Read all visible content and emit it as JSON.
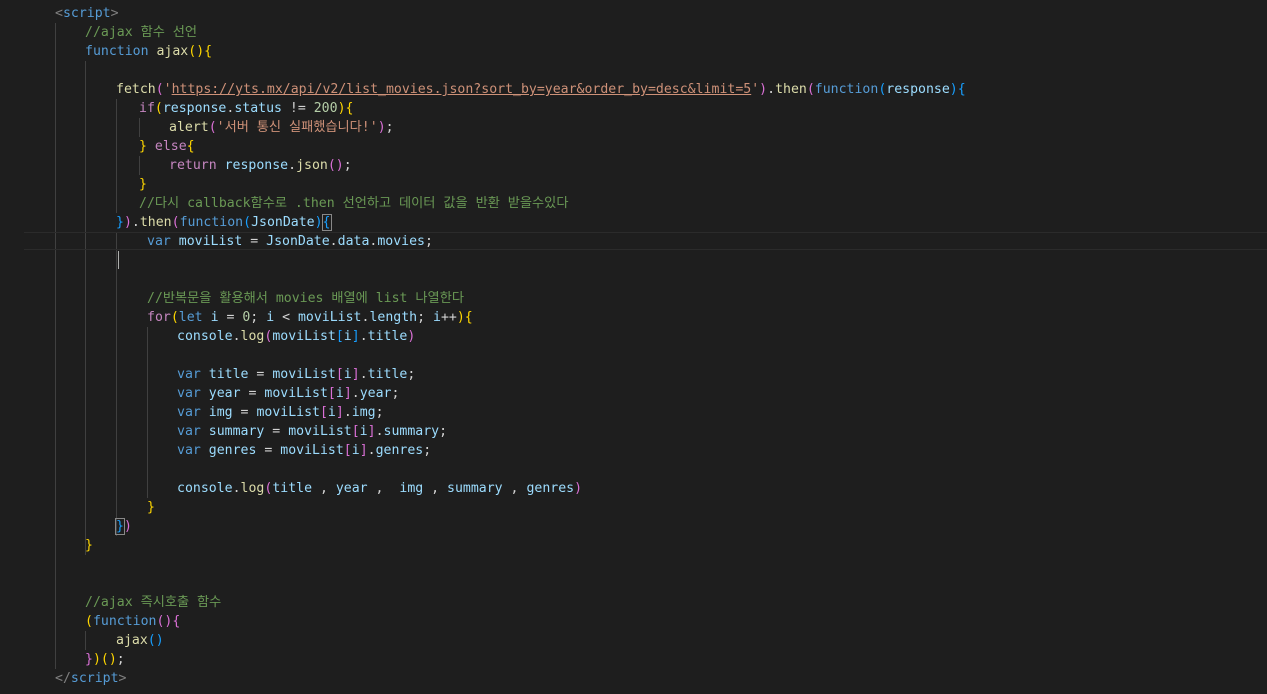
{
  "editor": {
    "colors": {
      "background": "#1e1e1e",
      "keyword": "#569cd6",
      "control": "#c586c0",
      "function": "#dcdcaa",
      "string": "#ce9178",
      "variable": "#9cdcfe",
      "number": "#b5cea8",
      "comment": "#6a9955"
    },
    "lines": [
      [
        {
          "t": "<",
          "c": "punc"
        },
        {
          "t": "script",
          "c": "tag"
        },
        {
          "t": ">",
          "c": "punc"
        }
      ],
      [
        {
          "t": "//ajax 함수 선언",
          "c": "com"
        }
      ],
      [
        {
          "t": "function",
          "c": "kw"
        },
        {
          "t": " "
        },
        {
          "t": "ajax",
          "c": "fn"
        },
        {
          "t": "(){",
          "c": "br1"
        }
      ],
      [],
      [
        {
          "t": "fetch",
          "c": "fn"
        },
        {
          "t": "(",
          "c": "br2"
        },
        {
          "t": "'",
          "c": "str"
        },
        {
          "t": "https://yts.mx/api/v2/list_movies.json?sort_by=year&order_by=desc&limit=5",
          "c": "url"
        },
        {
          "t": "'",
          "c": "str"
        },
        {
          "t": ")",
          "c": "br2"
        },
        {
          "t": "."
        },
        {
          "t": "then",
          "c": "fn"
        },
        {
          "t": "(",
          "c": "br2"
        },
        {
          "t": "function",
          "c": "kw"
        },
        {
          "t": "(",
          "c": "br3"
        },
        {
          "t": "response",
          "c": "var"
        },
        {
          "t": ")",
          "c": "br3"
        },
        {
          "t": "{",
          "c": "br3"
        }
      ],
      [
        {
          "t": "if",
          "c": "ctrl"
        },
        {
          "t": "(",
          "c": "br1"
        },
        {
          "t": "response",
          "c": "var"
        },
        {
          "t": "."
        },
        {
          "t": "status",
          "c": "var"
        },
        {
          "t": " != "
        },
        {
          "t": "200",
          "c": "num"
        },
        {
          "t": ")",
          "c": "br1"
        },
        {
          "t": "{",
          "c": "br1"
        }
      ],
      [
        {
          "t": "alert",
          "c": "fn"
        },
        {
          "t": "(",
          "c": "br2"
        },
        {
          "t": "'서버 통신 실패했습니다!'",
          "c": "str"
        },
        {
          "t": ")",
          "c": "br2"
        },
        {
          "t": ";"
        }
      ],
      [
        {
          "t": "}",
          "c": "br1"
        },
        {
          "t": " "
        },
        {
          "t": "else",
          "c": "ctrl"
        },
        {
          "t": "{",
          "c": "br1"
        }
      ],
      [
        {
          "t": "return",
          "c": "ctrl"
        },
        {
          "t": " "
        },
        {
          "t": "response",
          "c": "var"
        },
        {
          "t": "."
        },
        {
          "t": "json",
          "c": "fn"
        },
        {
          "t": "()",
          "c": "br2"
        },
        {
          "t": ";"
        }
      ],
      [
        {
          "t": "}",
          "c": "br1"
        }
      ],
      [
        {
          "t": "//다시 callback함수로 .then 선언하고 데이터 값을 반환 받을수있다",
          "c": "com"
        }
      ],
      [
        {
          "t": "}",
          "c": "br3"
        },
        {
          "t": ")",
          "c": "br2"
        },
        {
          "t": "."
        },
        {
          "t": "then",
          "c": "fn"
        },
        {
          "t": "(",
          "c": "br2"
        },
        {
          "t": "function",
          "c": "kw"
        },
        {
          "t": "(",
          "c": "br3"
        },
        {
          "t": "JsonDate",
          "c": "var"
        },
        {
          "t": ")",
          "c": "br3"
        },
        {
          "t": "{",
          "c": "br3",
          "m": 1
        }
      ],
      [
        {
          "t": "var",
          "c": "kw"
        },
        {
          "t": " "
        },
        {
          "t": "moviList",
          "c": "var"
        },
        {
          "t": " = "
        },
        {
          "t": "JsonDate",
          "c": "var"
        },
        {
          "t": "."
        },
        {
          "t": "data",
          "c": "var"
        },
        {
          "t": "."
        },
        {
          "t": "movies",
          "c": "var"
        },
        {
          "t": ";"
        }
      ],
      [],
      [],
      [
        {
          "t": "//반복문을 활용해서 movies 배열에 list 나열한다",
          "c": "com"
        }
      ],
      [
        {
          "t": "for",
          "c": "ctrl"
        },
        {
          "t": "(",
          "c": "br1"
        },
        {
          "t": "let",
          "c": "kw"
        },
        {
          "t": " "
        },
        {
          "t": "i",
          "c": "var"
        },
        {
          "t": " = "
        },
        {
          "t": "0",
          "c": "num"
        },
        {
          "t": "; "
        },
        {
          "t": "i",
          "c": "var"
        },
        {
          "t": " < "
        },
        {
          "t": "moviList",
          "c": "var"
        },
        {
          "t": "."
        },
        {
          "t": "length",
          "c": "var"
        },
        {
          "t": "; "
        },
        {
          "t": "i",
          "c": "var"
        },
        {
          "t": "++"
        },
        {
          "t": ")",
          "c": "br1"
        },
        {
          "t": "{",
          "c": "br1"
        }
      ],
      [
        {
          "t": "console",
          "c": "var"
        },
        {
          "t": "."
        },
        {
          "t": "log",
          "c": "fn"
        },
        {
          "t": "(",
          "c": "br2"
        },
        {
          "t": "moviList",
          "c": "var"
        },
        {
          "t": "[",
          "c": "br3"
        },
        {
          "t": "i",
          "c": "var"
        },
        {
          "t": "]",
          "c": "br3"
        },
        {
          "t": "."
        },
        {
          "t": "title",
          "c": "var"
        },
        {
          "t": ")",
          "c": "br2"
        }
      ],
      [],
      [
        {
          "t": "var",
          "c": "kw"
        },
        {
          "t": " "
        },
        {
          "t": "title",
          "c": "var"
        },
        {
          "t": " = "
        },
        {
          "t": "moviList",
          "c": "var"
        },
        {
          "t": "[",
          "c": "br2"
        },
        {
          "t": "i",
          "c": "var"
        },
        {
          "t": "]",
          "c": "br2"
        },
        {
          "t": "."
        },
        {
          "t": "title",
          "c": "var"
        },
        {
          "t": ";"
        }
      ],
      [
        {
          "t": "var",
          "c": "kw"
        },
        {
          "t": " "
        },
        {
          "t": "year",
          "c": "var"
        },
        {
          "t": " = "
        },
        {
          "t": "moviList",
          "c": "var"
        },
        {
          "t": "[",
          "c": "br2"
        },
        {
          "t": "i",
          "c": "var"
        },
        {
          "t": "]",
          "c": "br2"
        },
        {
          "t": "."
        },
        {
          "t": "year",
          "c": "var"
        },
        {
          "t": ";"
        }
      ],
      [
        {
          "t": "var",
          "c": "kw"
        },
        {
          "t": " "
        },
        {
          "t": "img",
          "c": "var"
        },
        {
          "t": " = "
        },
        {
          "t": "moviList",
          "c": "var"
        },
        {
          "t": "[",
          "c": "br2"
        },
        {
          "t": "i",
          "c": "var"
        },
        {
          "t": "]",
          "c": "br2"
        },
        {
          "t": "."
        },
        {
          "t": "img",
          "c": "var"
        },
        {
          "t": ";"
        }
      ],
      [
        {
          "t": "var",
          "c": "kw"
        },
        {
          "t": " "
        },
        {
          "t": "summary",
          "c": "var"
        },
        {
          "t": " = "
        },
        {
          "t": "moviList",
          "c": "var"
        },
        {
          "t": "[",
          "c": "br2"
        },
        {
          "t": "i",
          "c": "var"
        },
        {
          "t": "]",
          "c": "br2"
        },
        {
          "t": "."
        },
        {
          "t": "summary",
          "c": "var"
        },
        {
          "t": ";"
        }
      ],
      [
        {
          "t": "var",
          "c": "kw"
        },
        {
          "t": " "
        },
        {
          "t": "genres",
          "c": "var"
        },
        {
          "t": " = "
        },
        {
          "t": "moviList",
          "c": "var"
        },
        {
          "t": "[",
          "c": "br2"
        },
        {
          "t": "i",
          "c": "var"
        },
        {
          "t": "]",
          "c": "br2"
        },
        {
          "t": "."
        },
        {
          "t": "genres",
          "c": "var"
        },
        {
          "t": ";"
        }
      ],
      [],
      [
        {
          "t": "console",
          "c": "var"
        },
        {
          "t": "."
        },
        {
          "t": "log",
          "c": "fn"
        },
        {
          "t": "(",
          "c": "br2"
        },
        {
          "t": "title",
          "c": "var"
        },
        {
          "t": " , "
        },
        {
          "t": "year",
          "c": "var"
        },
        {
          "t": " ,  "
        },
        {
          "t": "img",
          "c": "var"
        },
        {
          "t": " , "
        },
        {
          "t": "summary",
          "c": "var"
        },
        {
          "t": " , "
        },
        {
          "t": "genres",
          "c": "var"
        },
        {
          "t": ")",
          "c": "br2"
        }
      ],
      [
        {
          "t": "}",
          "c": "br1"
        }
      ],
      [
        {
          "t": "}",
          "c": "br3",
          "m": 1
        },
        {
          "t": ")",
          "c": "br2"
        }
      ],
      [
        {
          "t": "}",
          "c": "br1"
        }
      ],
      [],
      [],
      [
        {
          "t": "//ajax 즉시호출 함수",
          "c": "com"
        }
      ],
      [
        {
          "t": "(",
          "c": "br1"
        },
        {
          "t": "function",
          "c": "kw"
        },
        {
          "t": "()",
          "c": "br2"
        },
        {
          "t": "{",
          "c": "br2"
        }
      ],
      [
        {
          "t": "ajax",
          "c": "fn"
        },
        {
          "t": "()",
          "c": "br3"
        }
      ],
      [
        {
          "t": "}",
          "c": "br2"
        },
        {
          "t": ")",
          "c": "br1"
        },
        {
          "t": "()",
          "c": "br1"
        },
        {
          "t": ";"
        }
      ],
      [
        {
          "t": "</",
          "c": "punc"
        },
        {
          "t": "script",
          "c": "tag"
        },
        {
          "t": ">",
          "c": "punc"
        }
      ]
    ]
  }
}
